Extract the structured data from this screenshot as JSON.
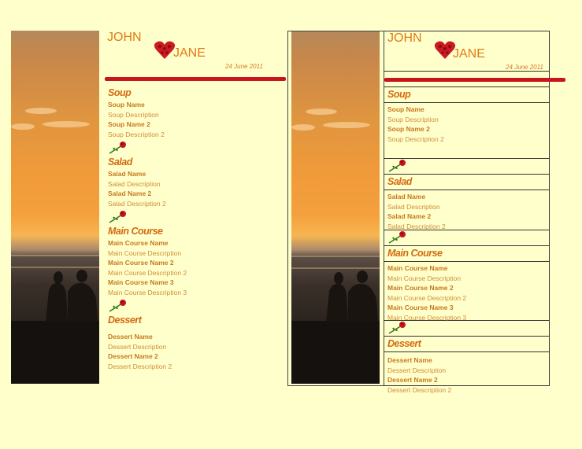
{
  "couple": {
    "groom": "JOHN",
    "bride": "JANE"
  },
  "date": "24 June 2011",
  "menu": [
    {
      "title": "Soup",
      "items": [
        {
          "name": "Soup Name",
          "description": "Soup Description"
        },
        {
          "name": "Soup Name 2",
          "description": "Soup Description 2"
        }
      ]
    },
    {
      "title": "Salad",
      "items": [
        {
          "name": "Salad Name",
          "description": "Salad Description"
        },
        {
          "name": "Salad Name 2",
          "description": "Salad Description 2"
        }
      ]
    },
    {
      "title": "Main Course",
      "items": [
        {
          "name": "Main Course Name",
          "description": "Main Course Description"
        },
        {
          "name": "Main Course Name 2",
          "description": "Main Course Description 2"
        },
        {
          "name": "Main Course Name 3",
          "description": "Main Course Description 3"
        }
      ]
    },
    {
      "title": "Dessert",
      "items": [
        {
          "name": "Dessert Name",
          "description": "Dessert Description"
        },
        {
          "name": "Dessert Name 2",
          "description": "Dessert Description 2"
        }
      ]
    }
  ],
  "colors": {
    "background": "#ffffcc",
    "accent_text": "#e07a14",
    "red_rule": "#c8141e"
  },
  "icons": [
    "heart-of-roses-icon",
    "rose-icon",
    "sunset-couple-photo"
  ]
}
